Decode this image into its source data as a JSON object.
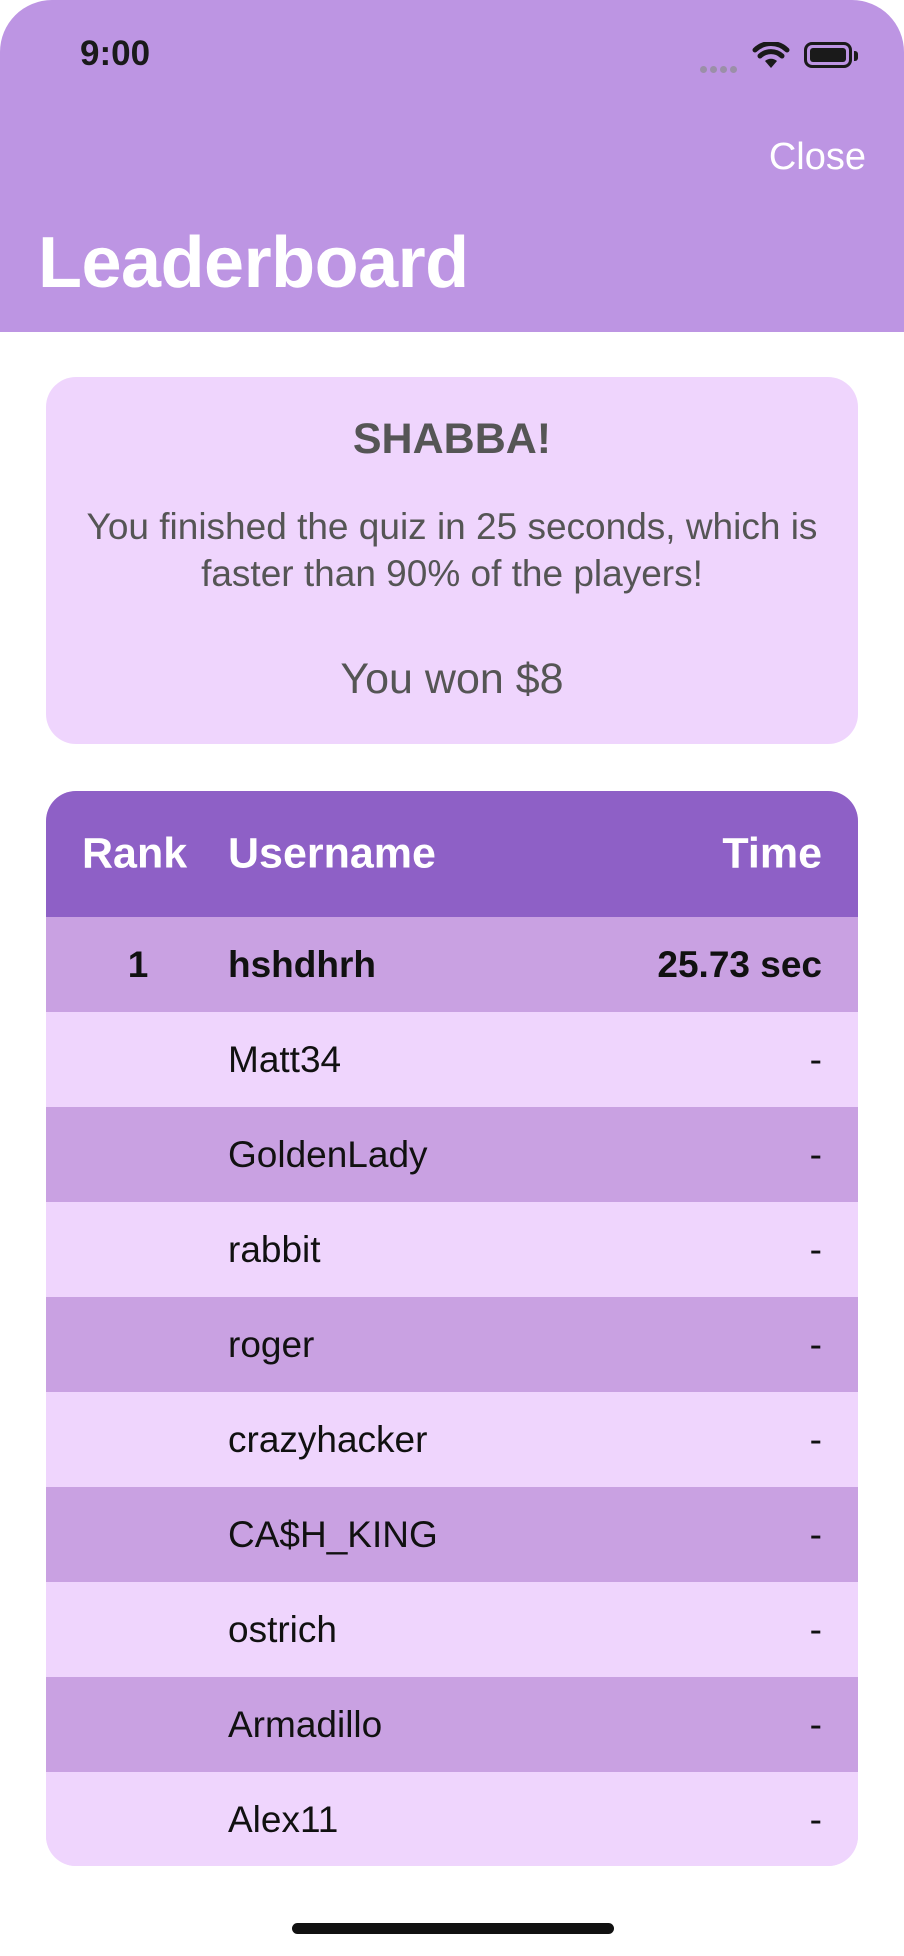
{
  "status_bar": {
    "time": "9:00"
  },
  "nav": {
    "close_label": "Close",
    "title": "Leaderboard"
  },
  "result": {
    "heading": "SHABBA!",
    "message": "You finished the quiz in 25 seconds, which is faster than 90% of the players!",
    "prize": "You won $8"
  },
  "table": {
    "headers": {
      "rank": "Rank",
      "username": "Username",
      "time": "Time"
    },
    "rows": [
      {
        "rank": "1",
        "username": "hshdhrh",
        "time": "25.73 sec"
      },
      {
        "rank": "",
        "username": "Matt34",
        "time": "-"
      },
      {
        "rank": "",
        "username": "GoldenLady",
        "time": "-"
      },
      {
        "rank": "",
        "username": "rabbit",
        "time": "-"
      },
      {
        "rank": "",
        "username": "roger",
        "time": "-"
      },
      {
        "rank": "",
        "username": "crazyhacker",
        "time": "-"
      },
      {
        "rank": "",
        "username": "CA$H_KING",
        "time": "-"
      },
      {
        "rank": "",
        "username": "ostrich",
        "time": "-"
      },
      {
        "rank": "",
        "username": "Armadillo",
        "time": "-"
      },
      {
        "rank": "",
        "username": "Alex11",
        "time": "-"
      }
    ]
  },
  "colors": {
    "header_bg": "#bd95e3",
    "card_bg": "#efd5fd",
    "table_header_bg": "#8e60c6",
    "row_alt_bg": "#c9a1e2"
  },
  "icons": [
    "cellular-signal-icon",
    "wifi-icon",
    "battery-icon"
  ]
}
